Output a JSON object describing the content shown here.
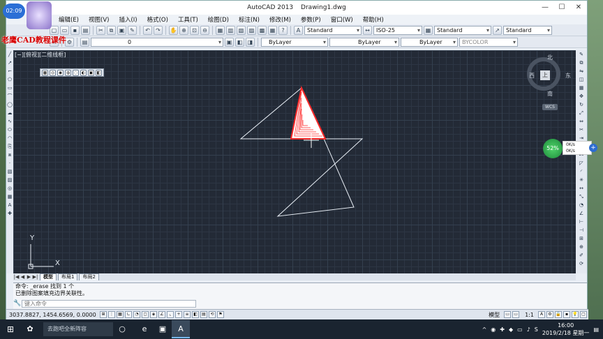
{
  "window": {
    "app_name": "AutoCAD 2013",
    "file_name": "Drawing1.dwg",
    "minimize": "—",
    "maximize": "☐",
    "close": "✕"
  },
  "overlay": {
    "clock_badge": "02:09",
    "brand_text": "老鹰CAD教程课件"
  },
  "menu": [
    "编辑(E)",
    "视图(V)",
    "插入(I)",
    "格式(O)",
    "工具(T)",
    "绘图(D)",
    "标注(N)",
    "修改(M)",
    "参数(P)",
    "窗口(W)",
    "帮助(H)"
  ],
  "styles": {
    "text_style": "Standard",
    "dim_style": "ISO-25",
    "table_style": "Standard",
    "mleader_style": "Standard"
  },
  "layers": {
    "current_layer": "0",
    "color": "ByLayer",
    "linetype": "ByLayer",
    "lineweight": "ByLayer",
    "plot_style": "BYCOLOR"
  },
  "viewport": {
    "label": "[−][俯视][二维线框]"
  },
  "viewcube": {
    "north": "北",
    "south": "南",
    "east": "东",
    "west": "西",
    "face": "上",
    "wcs": "WCS"
  },
  "net_widget": {
    "percent": "52%",
    "up_rate": "0K/s",
    "down_rate": "0K/s"
  },
  "ucs": {
    "x": "X",
    "y": "Y"
  },
  "tabs": {
    "nav": [
      "|◀",
      "◀",
      "▶",
      "▶|"
    ],
    "items": [
      "模型",
      "布局1",
      "布局2"
    ]
  },
  "command": {
    "line1": "命令: _erase 找到 1 个",
    "line2": "已删除图案填充边界关联性。",
    "prompt": "键入命令"
  },
  "status": {
    "coords": "3037.8827, 1454.6569, 0.0000",
    "model_label": "模型",
    "scale": "1:1"
  },
  "taskbar": {
    "search_text": "去跑吧全新阵容",
    "time": "16:00",
    "date": "2019/2/18 星期一",
    "lang": "S"
  }
}
